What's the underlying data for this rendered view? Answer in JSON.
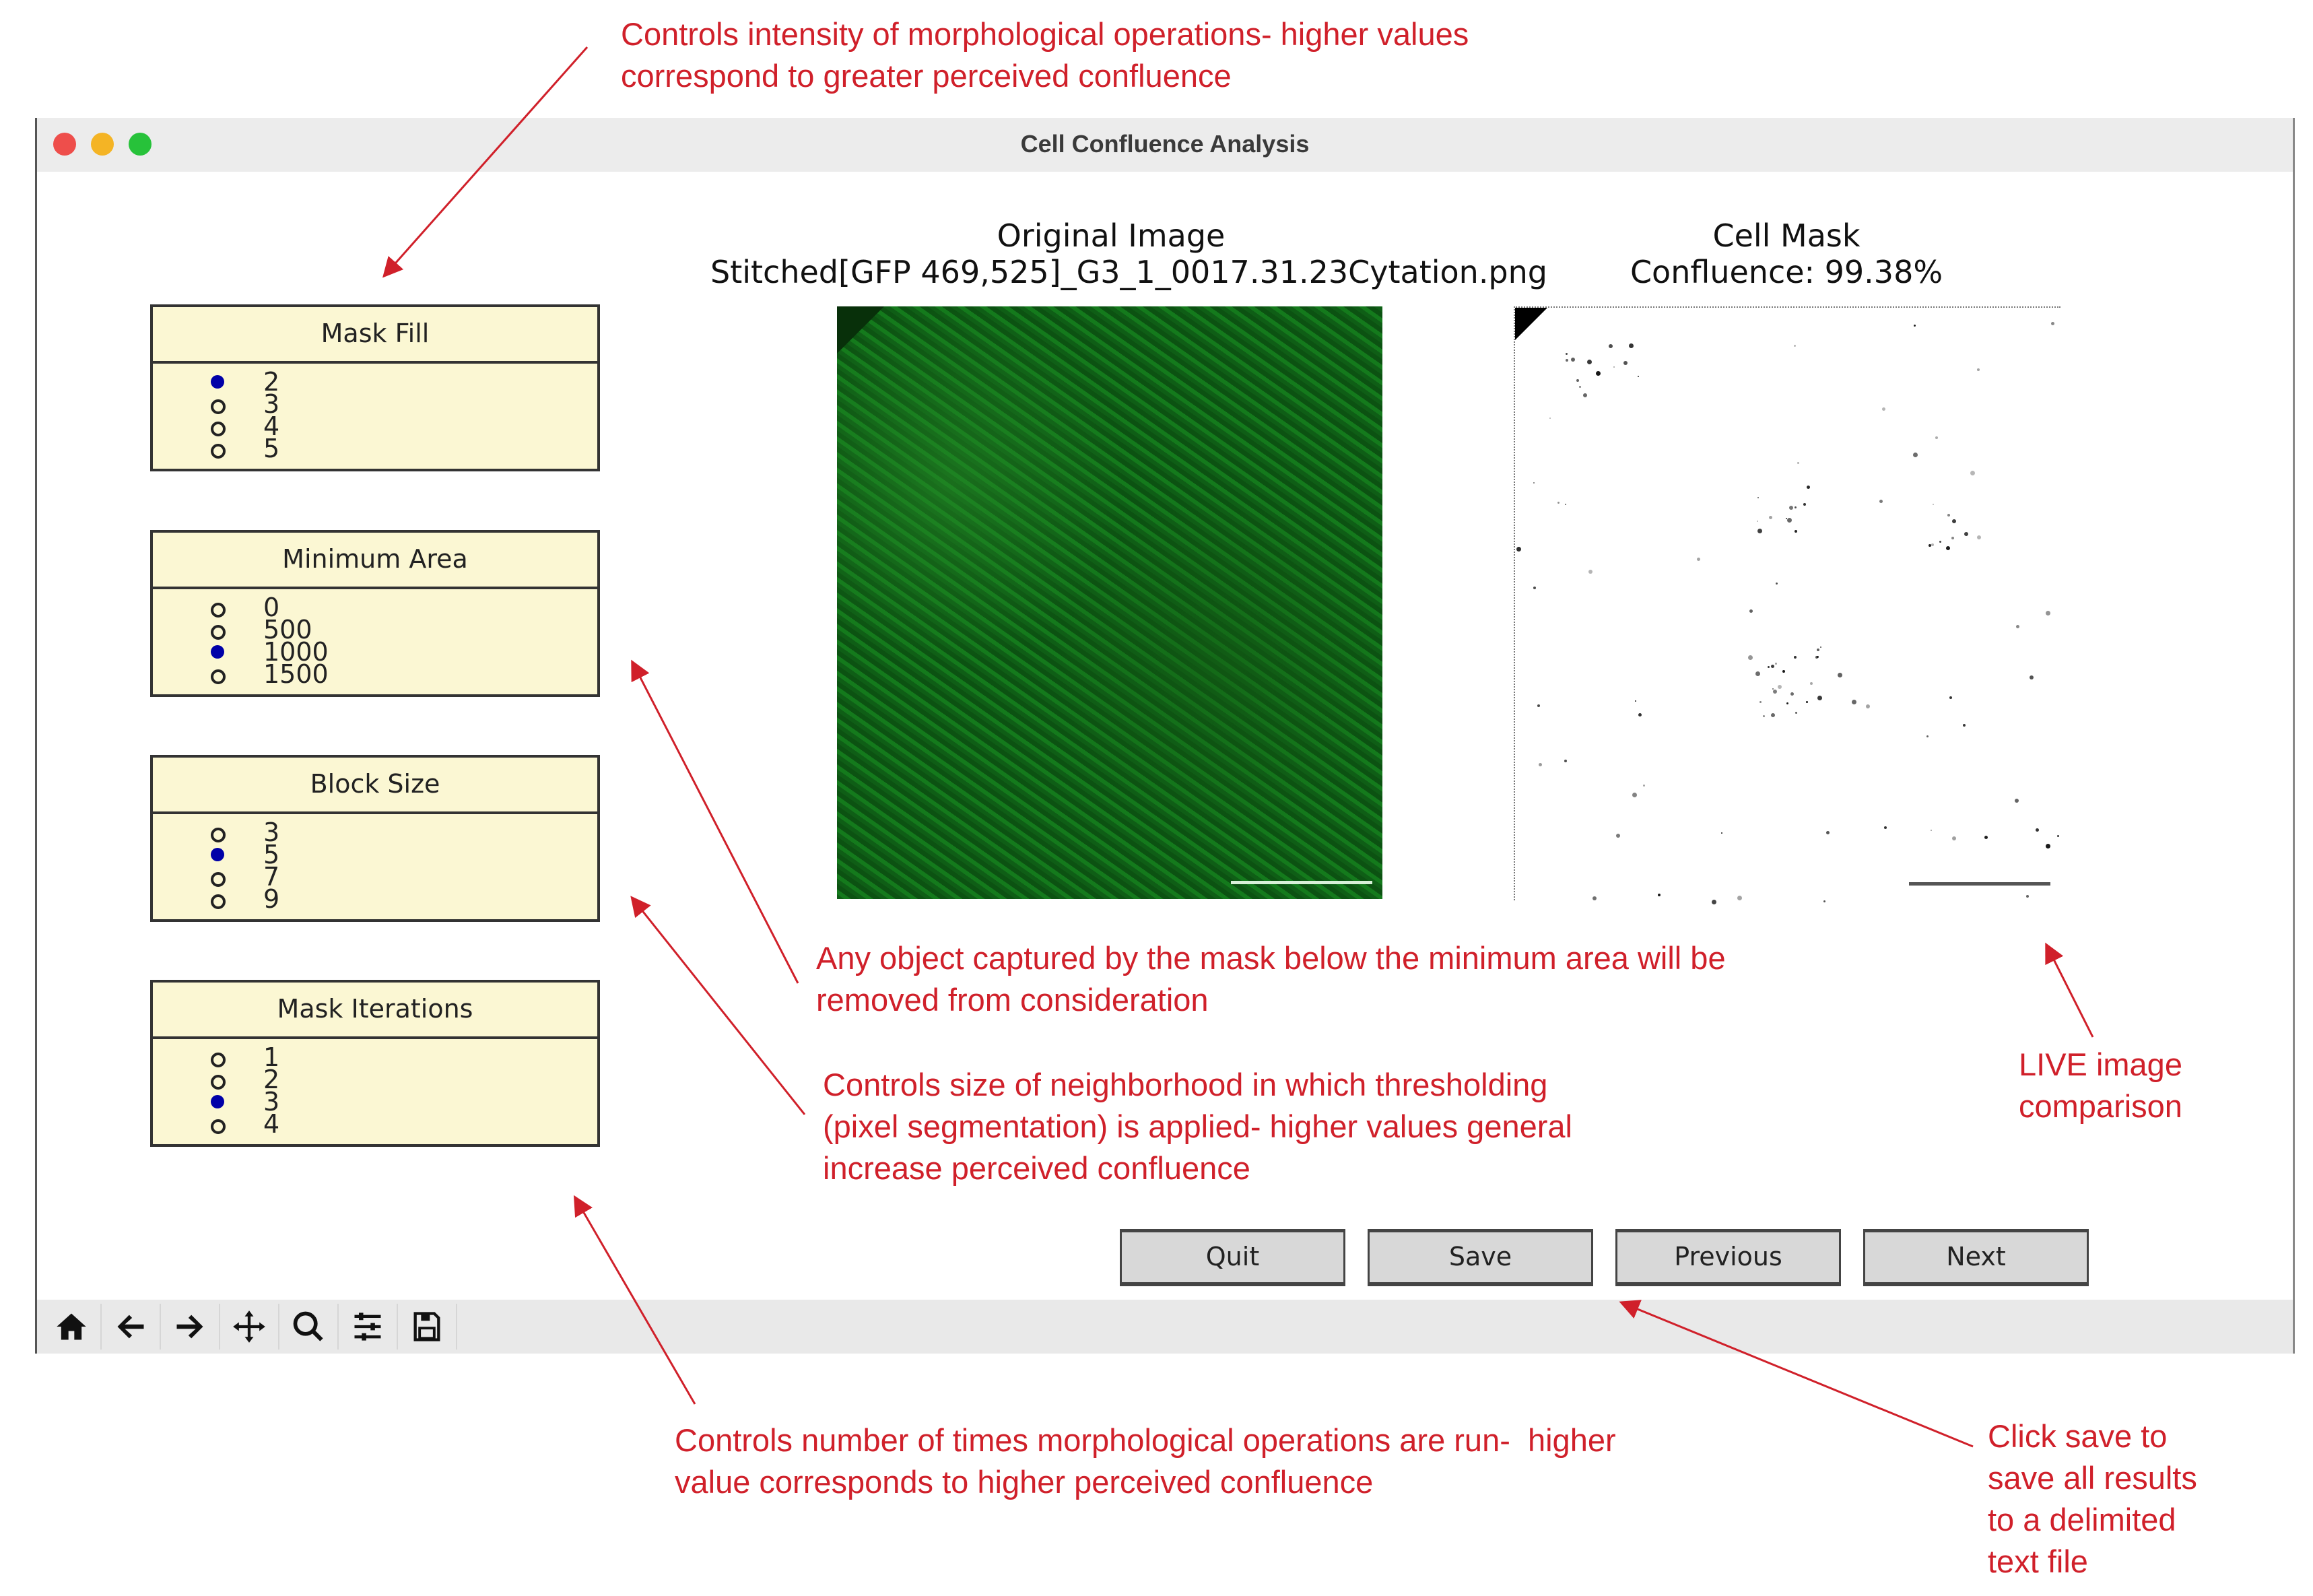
{
  "window": {
    "title": "Cell Confluence Analysis",
    "traffic_lights": [
      {
        "name": "close",
        "color": "#ee4e4b"
      },
      {
        "name": "minimize",
        "color": "#f4b425"
      },
      {
        "name": "maximize",
        "color": "#27c23a"
      }
    ]
  },
  "panels": [
    {
      "title": "Mask Fill",
      "options": [
        "2",
        "3",
        "4",
        "5"
      ],
      "selected": "2"
    },
    {
      "title": "Minimum Area",
      "options": [
        "0",
        "500",
        "1000",
        "1500"
      ],
      "selected": "1000"
    },
    {
      "title": "Block Size",
      "options": [
        "3",
        "5",
        "7",
        "9"
      ],
      "selected": "5"
    },
    {
      "title": "Mask Iterations",
      "options": [
        "1",
        "2",
        "3",
        "4"
      ],
      "selected": "3"
    }
  ],
  "original": {
    "title": "Original Image",
    "filename": "Stitched[GFP 469,525]_G3_1_0017.31.23Cytation.png"
  },
  "mask": {
    "title": "Cell Mask",
    "confluence": "Confluence: 99.38%"
  },
  "buttons": {
    "quit": "Quit",
    "save": "Save",
    "previous": "Previous",
    "next": "Next"
  },
  "toolbar": {
    "icons": [
      "home-icon",
      "back-arrow-icon",
      "forward-arrow-icon",
      "pan-move-icon",
      "zoom-magnifier-icon",
      "configure-subplots-icon",
      "save-floppy-icon"
    ]
  },
  "annotations": {
    "mask_fill": "Controls intensity of morphological operations- higher values\ncorrespond to greater perceived confluence",
    "min_area": "Any object captured by the mask below the minimum area will be\nremoved from consideration",
    "block_size": "Controls size of neighborhood in which thresholding\n(pixel segmentation) is applied- higher values general\nincrease perceived confluence",
    "mask_iterations": "Controls number of times morphological operations are run-  higher\nvalue corresponds to higher perceived confluence",
    "live": "LIVE image\ncomparison",
    "save": "Click save to\nsave all results\nto a delimited\ntext file",
    "color": "#d0202a"
  }
}
